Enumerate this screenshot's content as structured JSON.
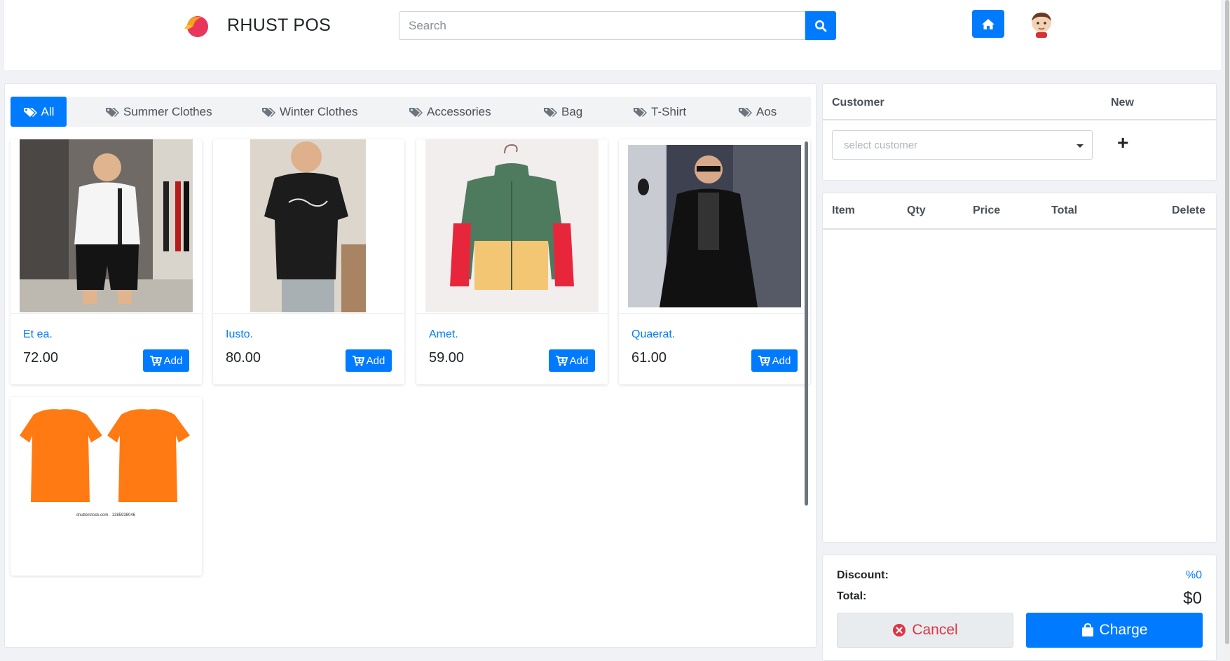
{
  "header": {
    "brand": "RHUST POS",
    "search_placeholder": "Search"
  },
  "categories": [
    {
      "label": "All",
      "active": true
    },
    {
      "label": "Summer Clothes",
      "active": false
    },
    {
      "label": "Winter Clothes",
      "active": false
    },
    {
      "label": "Accessories",
      "active": false
    },
    {
      "label": "Bag",
      "active": false
    },
    {
      "label": "T-Shirt",
      "active": false
    },
    {
      "label": "Aos",
      "active": false
    }
  ],
  "products": [
    {
      "name": "Et ea.",
      "price": "72.00",
      "add_label": "Add"
    },
    {
      "name": "Iusto.",
      "price": "80.00",
      "add_label": "Add"
    },
    {
      "name": "Amet.",
      "price": "59.00",
      "add_label": "Add"
    },
    {
      "name": "Quaerat.",
      "price": "61.00",
      "add_label": "Add"
    },
    {
      "name": "",
      "price": "",
      "add_label": ""
    }
  ],
  "image_caption": "shutterstock.com · 1385938046",
  "customer": {
    "header_label": "Customer",
    "new_label": "New",
    "select_placeholder": "select customer",
    "add_symbol": "+"
  },
  "cart": {
    "columns": [
      "Item",
      "Qty",
      "Price",
      "Total",
      "Delete"
    ],
    "rows": []
  },
  "summary": {
    "discount_label": "Discount:",
    "discount_value": "%0",
    "total_label": "Total:",
    "total_value": "$0",
    "cancel_label": "Cancel",
    "charge_label": "Charge"
  },
  "colors": {
    "primary": "#007bff",
    "danger": "#dc3545",
    "background": "#f0f2f5"
  }
}
